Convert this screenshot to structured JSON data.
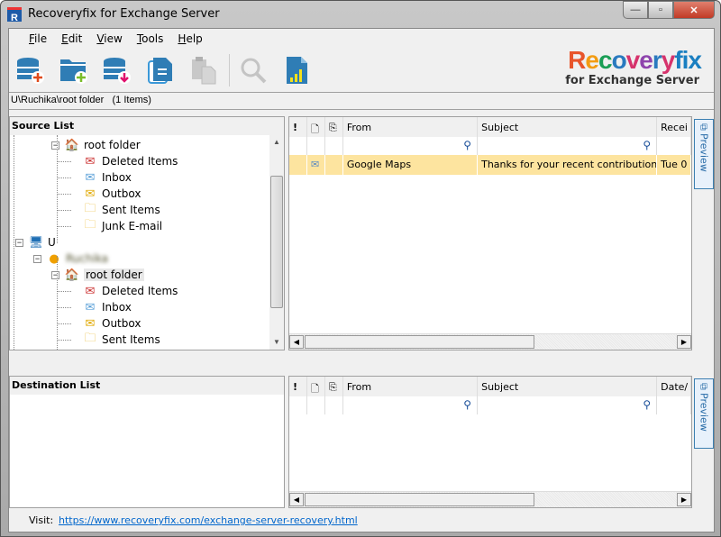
{
  "window": {
    "title": "Recoveryfix for Exchange Server",
    "app_icon_letter": "R",
    "minimize": "—",
    "maximize": "▫",
    "close": "✕"
  },
  "menu": [
    {
      "label": "File",
      "mnemonic": "F",
      "rest": "ile"
    },
    {
      "label": "Edit",
      "mnemonic": "E",
      "rest": "dit"
    },
    {
      "label": "View",
      "mnemonic": "V",
      "rest": "iew"
    },
    {
      "label": "Tools",
      "mnemonic": "T",
      "rest": "ools"
    },
    {
      "label": "Help",
      "mnemonic": "H",
      "rest": "elp"
    }
  ],
  "toolbar": [
    {
      "name": "add-database",
      "icon": "database-add-icon",
      "enabled": true
    },
    {
      "name": "add-folder",
      "icon": "folder-add-icon",
      "enabled": true
    },
    {
      "name": "save-database",
      "icon": "database-export-icon",
      "enabled": true
    },
    {
      "name": "copy",
      "icon": "document-copy-icon",
      "enabled": true
    },
    {
      "name": "paste",
      "icon": "paste-icon",
      "enabled": false
    },
    {
      "name": "search",
      "icon": "search-icon",
      "enabled": false
    },
    {
      "name": "report",
      "icon": "report-icon",
      "enabled": true
    }
  ],
  "logo": {
    "word": [
      "R",
      "e",
      "c",
      "o",
      "v",
      "e",
      "r",
      "y",
      "f",
      "i",
      "x"
    ],
    "colors": [
      "#e8552b",
      "#f39c12",
      "#1a9e55",
      "#2a7abf",
      "#d6336c",
      "#8e44ad",
      "#2a7abf",
      "#d6336c",
      "#1a7fc1",
      "#1a7fc1",
      "#1a7fc1"
    ],
    "subtitle": "for Exchange Server"
  },
  "path": {
    "text": "U\\Ruchika\\root folder",
    "count": "(1 Items)"
  },
  "source": {
    "title": "Source List",
    "tree": [
      {
        "label": "root folder",
        "icon": "root-folder-icon",
        "level": 2,
        "expander": true
      },
      {
        "label": "Deleted Items",
        "icon": "deleted-items-icon",
        "level": 3
      },
      {
        "label": "Inbox",
        "icon": "inbox-icon",
        "level": 3
      },
      {
        "label": "Outbox",
        "icon": "outbox-icon",
        "level": 3
      },
      {
        "label": "Sent Items",
        "icon": "sent-items-icon",
        "level": 3
      },
      {
        "label": "Junk E-mail",
        "icon": "junk-folder-icon",
        "level": 3
      },
      {
        "label": "U",
        "icon": "computer-icon",
        "level": 0,
        "expander": true
      },
      {
        "label": "Ruchika",
        "icon": "user-icon",
        "level": 1,
        "expander": true,
        "blurred": true
      },
      {
        "label": "root folder",
        "icon": "root-folder-icon",
        "level": 2,
        "expander": true,
        "selected": true
      },
      {
        "label": "Deleted Items",
        "icon": "deleted-items-icon",
        "level": 3
      },
      {
        "label": "Inbox",
        "icon": "inbox-icon",
        "level": 3
      },
      {
        "label": "Outbox",
        "icon": "outbox-icon",
        "level": 3
      },
      {
        "label": "Sent Items",
        "icon": "sent-items-icon",
        "level": 3
      }
    ]
  },
  "source_grid": {
    "columns": [
      "!",
      "",
      "",
      "From",
      "Subject",
      "Recei"
    ],
    "rows": [
      {
        "from": "Google Maps",
        "subject": "Thanks for your recent contributions",
        "received": "Tue 0"
      }
    ]
  },
  "destination": {
    "title": "Destination List"
  },
  "dest_grid": {
    "columns": [
      "!",
      "",
      "",
      "From",
      "Subject",
      "Date/"
    ]
  },
  "preview": {
    "label": "Preview"
  },
  "status": {
    "visit": "Visit:",
    "url": "https://www.recoveryfix.com/exchange-server-recovery.html"
  }
}
